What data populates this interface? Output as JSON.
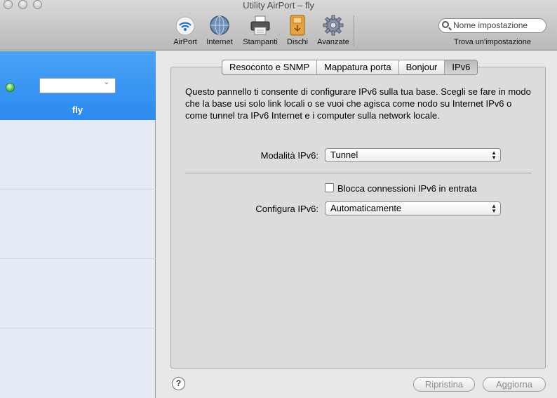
{
  "window": {
    "title": "Utility AirPort – fly"
  },
  "toolbar": {
    "items": [
      {
        "label": "AirPort",
        "icon": "airport-wifi-icon"
      },
      {
        "label": "Internet",
        "icon": "globe-icon"
      },
      {
        "label": "Stampanti",
        "icon": "printer-icon"
      },
      {
        "label": "Dischi",
        "icon": "disk-icon"
      },
      {
        "label": "Avanzate",
        "icon": "gear-icon"
      }
    ],
    "search_placeholder": "Nome impostazione",
    "search_caption": "Trova un'impostazione"
  },
  "sidebar": {
    "base": {
      "name": "fly",
      "status_color": "#55c043",
      "popup_value": ""
    }
  },
  "tabs": [
    {
      "label": "Resoconto e SNMP",
      "active": false
    },
    {
      "label": "Mappatura porta",
      "active": false
    },
    {
      "label": "Bonjour",
      "active": false
    },
    {
      "label": "IPv6",
      "active": true
    }
  ],
  "panel": {
    "description": "Questo pannello ti consente di configurare IPv6 sulla tua base. Scegli se fare in modo che la base usi solo link locali o se vuoi che agisca come nodo su Internet IPv6 o come tunnel tra IPv6 Internet e i computer sulla network locale.",
    "mode_label": "Modalità IPv6:",
    "mode_value": "Tunnel",
    "block_label": "Blocca connessioni IPv6 in entrata",
    "block_checked": false,
    "configure_label": "Configura IPv6:",
    "configure_value": "Automaticamente"
  },
  "footer": {
    "help": "?",
    "revert_label": "Ripristina",
    "update_label": "Aggiorna"
  },
  "colors": {
    "selection": "#2c8af0",
    "sidebar": "#e4ebf5",
    "panel": "#dcdcdc"
  }
}
